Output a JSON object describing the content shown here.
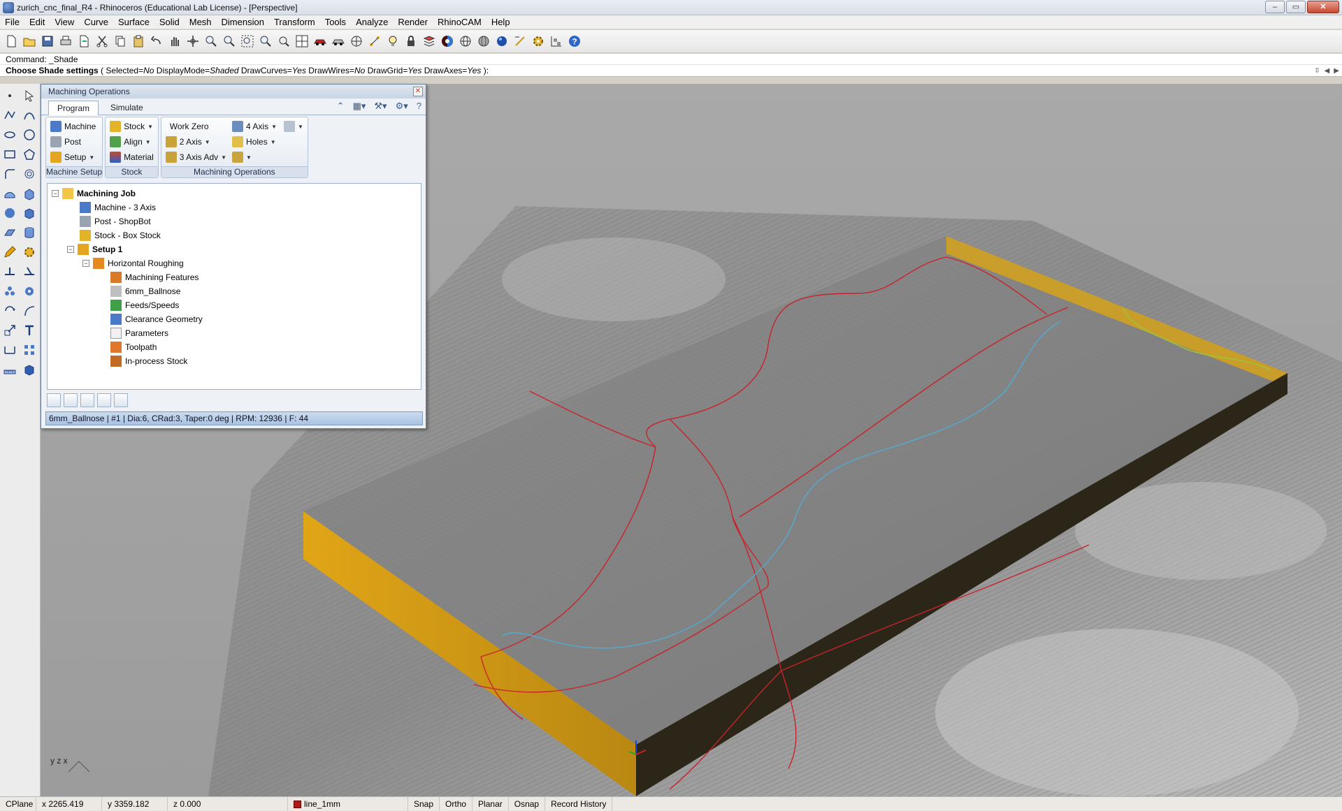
{
  "window": {
    "title": "zurich_cnc_final_R4 - Rhinoceros (Educational Lab License) - [Perspective]",
    "controls": [
      "–",
      "▭",
      "✕"
    ]
  },
  "menu": [
    "File",
    "Edit",
    "View",
    "Curve",
    "Surface",
    "Solid",
    "Mesh",
    "Dimension",
    "Transform",
    "Tools",
    "Analyze",
    "Render",
    "RhinoCAM",
    "Help"
  ],
  "command": {
    "history": "Command: _Shade",
    "prompt_label": "Choose Shade settings",
    "prompt_open": "(",
    "opt1_label": "Selected=",
    "opt1_value": "No",
    "opt2_label": "DisplayMode=",
    "opt2_value": "Shaded",
    "opt3_label": "DrawCurves=",
    "opt3_value": "Yes",
    "opt4_label": "DrawWires=",
    "opt4_value": "No",
    "opt5_label": "DrawGrid=",
    "opt5_value": "Yes",
    "opt6_label": "DrawAxes=",
    "opt6_value": "Yes",
    "prompt_close": "):"
  },
  "panel": {
    "title": "Machining Operations",
    "tabs": [
      "Program",
      "Simulate"
    ],
    "groups": {
      "machine_setup": {
        "label": "Machine Setup",
        "buttons": [
          "Machine",
          "Post",
          "Setup"
        ]
      },
      "stock": {
        "label": "Stock",
        "buttons": [
          "Stock",
          "Align",
          "Material"
        ]
      },
      "machining_ops": {
        "label": "Machining Operations",
        "buttons": [
          "Work Zero",
          "2 Axis",
          "3 Axis Adv",
          "4 Axis",
          "Holes"
        ]
      }
    },
    "tree": {
      "job": "Machining Job",
      "machine": "Machine - 3 Axis",
      "post": "Post - ShopBot",
      "stock": "Stock - Box Stock",
      "setup": "Setup 1",
      "operation": "Horizontal Roughing",
      "children": [
        "Machining Features",
        "6mm_Ballnose",
        "Feeds/Speeds",
        "Clearance Geometry",
        "Parameters",
        "Toolpath",
        "In-process Stock"
      ]
    },
    "status": "6mm_Ballnose | #1 | Dia:6, CRad:3, Taper:0 deg | RPM: 12936 | F: 44"
  },
  "viewport": {
    "axes_label": "y  z  x"
  },
  "statusbar": {
    "cplane": "CPlane",
    "x": "x 2265.419",
    "y": "y 3359.182",
    "z": "z 0.000",
    "layer": "line_1mm",
    "snap": "Snap",
    "ortho": "Ortho",
    "planar": "Planar",
    "osnap": "Osnap",
    "record_history": "Record History"
  },
  "colors": {
    "stock_orange": "#d6a21a",
    "toolpath_red": "#c8232b",
    "river_blue": "#5aa6c9",
    "boundary_green": "#9ec33a",
    "terrain_gray": "#8e8e8e"
  }
}
